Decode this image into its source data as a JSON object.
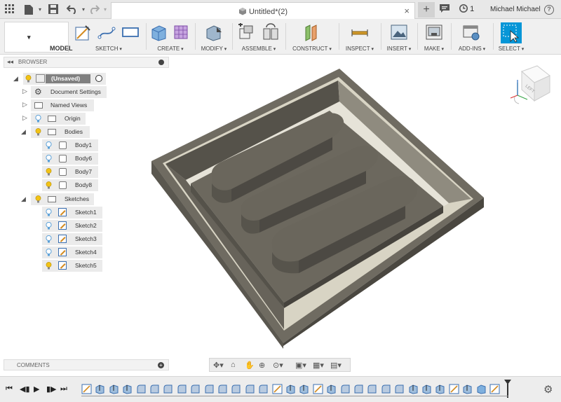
{
  "titlebar": {
    "document_title": "Untitled*(2)",
    "close_glyph": "×",
    "newtab_glyph": "+",
    "jobs_count": "1",
    "user_name": "Michael Michael",
    "help_glyph": "?"
  },
  "toolbar": {
    "workspace_label": "MODEL",
    "groups": [
      {
        "label": "SKETCH"
      },
      {
        "label": "CREATE"
      },
      {
        "label": "MODIFY"
      },
      {
        "label": "ASSEMBLE"
      },
      {
        "label": "CONSTRUCT"
      },
      {
        "label": "INSPECT"
      },
      {
        "label": "INSERT"
      },
      {
        "label": "MAKE"
      },
      {
        "label": "ADD-INS"
      },
      {
        "label": "SELECT"
      }
    ]
  },
  "browser": {
    "title": "BROWSER",
    "items": [
      {
        "label": "(Unsaved)"
      },
      {
        "label": "Document Settings"
      },
      {
        "label": "Named Views"
      },
      {
        "label": "Origin"
      },
      {
        "label": "Bodies"
      },
      {
        "label": "Body1"
      },
      {
        "label": "Body6"
      },
      {
        "label": "Body7"
      },
      {
        "label": "Body8"
      },
      {
        "label": "Sketches"
      },
      {
        "label": "Sketch1"
      },
      {
        "label": "Sketch2"
      },
      {
        "label": "Sketch3"
      },
      {
        "label": "Sketch4"
      },
      {
        "label": "Sketch5"
      }
    ]
  },
  "comments": {
    "title": "COMMENTS"
  },
  "viewcube": {
    "face_label": "LEFT"
  },
  "colors": {
    "accent": "#0696d7",
    "model_top": "#6b675c",
    "model_side_dark": "#4f4c44",
    "model_side_light": "#8a867a",
    "bulb": "#f2c316",
    "bulb_off": "#5aa0d8"
  },
  "icons": {
    "grid": "grid-icon",
    "file": "file-icon",
    "save": "save-icon",
    "undo": "undo-icon",
    "redo": "redo-icon",
    "settings": "gear-icon"
  }
}
